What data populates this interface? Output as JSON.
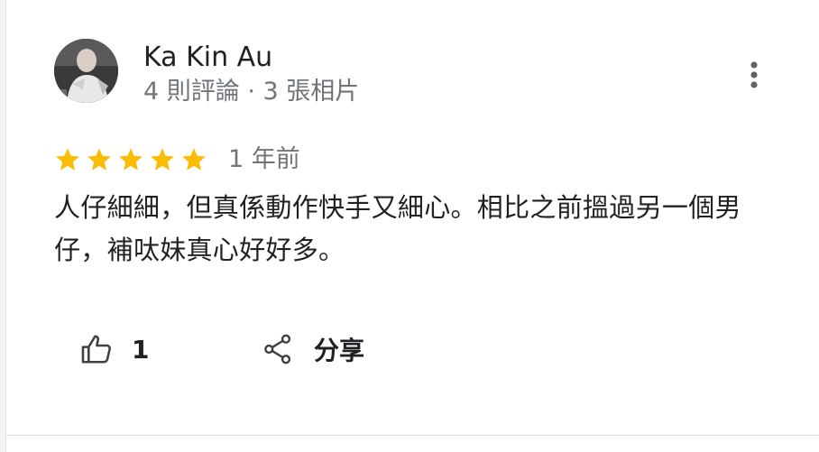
{
  "review": {
    "author_name": "Ka Kin Au",
    "author_meta": "4 則評論 · 3 張相片",
    "rating": 5,
    "rating_max": 5,
    "star_color": "#fbbc04",
    "date": "1 年前",
    "text": "人仔細細，但真係動作快手又細心。相比之前搵過另一個男仔，補呔妹真心好好多。"
  },
  "actions": {
    "like_icon": "thumbs-up-icon",
    "like_count": "1",
    "share_icon": "share-icon",
    "share_label": "分享",
    "more_icon": "more-vert-icon"
  }
}
